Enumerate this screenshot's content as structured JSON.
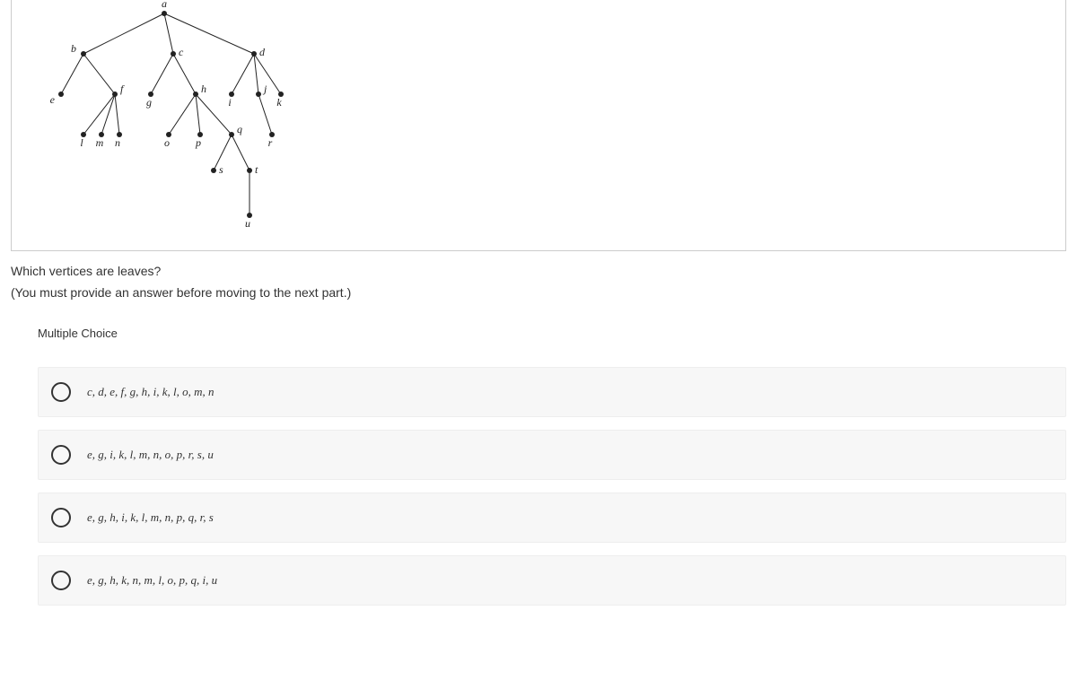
{
  "question": "Which vertices are leaves?",
  "instruction": "(You must provide an answer before moving to the next part.)",
  "mc_label": "Multiple Choice",
  "options": [
    "c, d, e, f, g, h, i, k, l, o, m, n",
    "e, g, i, k, l, m, n, o, p, r, s, u",
    "e, g, h, i, k, l, m, n, p, q, r, s",
    "e, g, h, k, n, m, l, o, p, q, i, u"
  ],
  "tree": {
    "labels": {
      "a": "a",
      "b": "b",
      "c": "c",
      "d": "d",
      "e": "e",
      "f": "f",
      "g": "g",
      "h": "h",
      "i": "i",
      "j": "j",
      "k": "k",
      "l": "l",
      "m": "m",
      "n": "n",
      "o": "o",
      "p": "p",
      "q": "q",
      "r": "r",
      "s": "s",
      "t": "t",
      "u": "u"
    }
  }
}
